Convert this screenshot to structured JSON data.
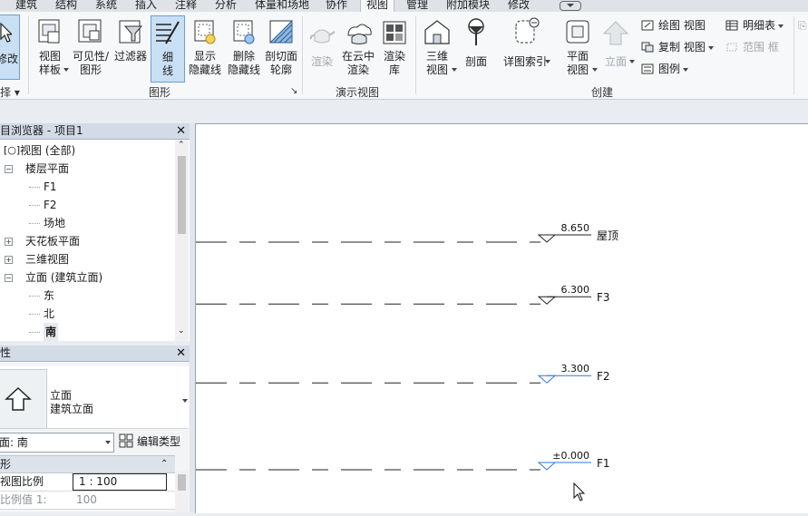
{
  "menu": {
    "tabs": [
      "建筑",
      "结构",
      "系统",
      "插入",
      "注释",
      "分析",
      "体量和场地",
      "协作",
      "视图",
      "管理",
      "附加模块",
      "修改"
    ],
    "active": "视图"
  },
  "ribbon": {
    "modify_label": "修改",
    "select_label": "择",
    "select_dd": "▾",
    "graphics": {
      "view_template": [
        "视图",
        "样板"
      ],
      "visibility": [
        "可见性/",
        "图形"
      ],
      "filters": "过滤器",
      "thin_lines": [
        "细",
        "线"
      ],
      "show_hidden": [
        "显示",
        "隐藏线"
      ],
      "remove_hidden": [
        "删除",
        "隐藏线"
      ],
      "cut_profile": [
        "剖切面",
        "轮廓"
      ],
      "group_label": "图形",
      "launcher": "↘"
    },
    "presentation": {
      "render": "渲染",
      "render_cloud": [
        "在云中",
        "渲染"
      ],
      "render_gallery": [
        "渲染",
        "库"
      ],
      "group_label": "演示视图"
    },
    "create": {
      "three_d": [
        "三维",
        "视图"
      ],
      "section": "剖面",
      "callout": "详图索引",
      "plan": [
        "平面",
        "视图"
      ],
      "elevation": "立面",
      "drafting_view": "绘图 视图",
      "duplicate_view": "复制 视图",
      "legend": "图例",
      "schedules": "明细表",
      "scope_box": "范围 框",
      "group_label": "创建"
    }
  },
  "browser": {
    "title": "目浏览器 - 项目1",
    "items": [
      {
        "label": "视图 (全部)",
        "level": 0,
        "expander": ""
      },
      {
        "label": "楼层平面",
        "level": 1,
        "expander": "−"
      },
      {
        "label": "F1",
        "level": 2,
        "expander": ""
      },
      {
        "label": "F2",
        "level": 2,
        "expander": ""
      },
      {
        "label": "场地",
        "level": 2,
        "expander": ""
      },
      {
        "label": "天花板平面",
        "level": 1,
        "expander": "+"
      },
      {
        "label": "三维视图",
        "level": 1,
        "expander": "+"
      },
      {
        "label": "立面 (建筑立面)",
        "level": 1,
        "expander": "−"
      },
      {
        "label": "东",
        "level": 2,
        "expander": ""
      },
      {
        "label": "北",
        "level": 2,
        "expander": ""
      },
      {
        "label": "南",
        "level": 2,
        "expander": "",
        "bold": true
      }
    ]
  },
  "properties": {
    "title": "性",
    "type_name": "立面",
    "type_sub": "建筑立面",
    "selector": "面: 南",
    "edit_type": "编辑类型",
    "section": "形",
    "rows": [
      {
        "label": "视图比例",
        "value": "1 : 100",
        "editable": true
      },
      {
        "label": "比例值 1:",
        "value": "100",
        "editable": false
      }
    ]
  },
  "canvas": {
    "levels": [
      {
        "name": "屋顶",
        "elevation": "8.650",
        "elev_m": 8.65
      },
      {
        "name": "F3",
        "elevation": "6.300",
        "elev_m": 6.3
      },
      {
        "name": "F2",
        "elevation": "3.300",
        "elev_m": 3.3
      },
      {
        "name": "F1",
        "elevation": "±0.000",
        "elev_m": 0
      }
    ]
  },
  "colors": {
    "level_marker": "#2b7bd6",
    "accent": "#6a9fd4"
  }
}
